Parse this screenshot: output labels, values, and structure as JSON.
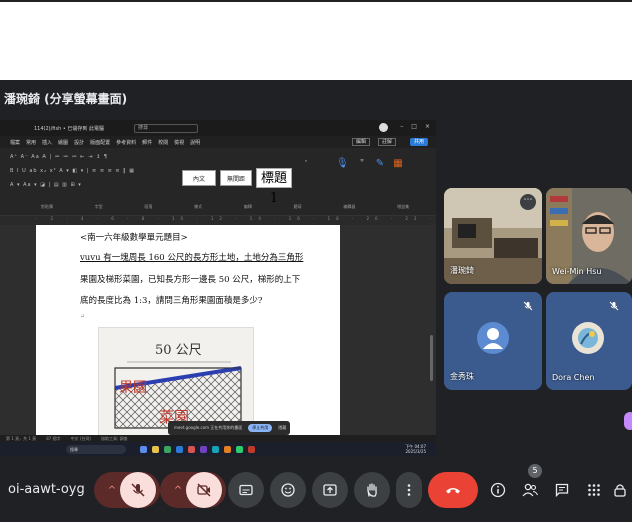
{
  "meeting": {
    "presenter_title": "潘琬錡 (分享螢幕畫面)",
    "meeting_code": "oi-aawt-oyg",
    "participant_count": "5"
  },
  "shared_screen": {
    "titlebar": {
      "doc_name": "114(2)/fish • 已儲存到 此電腦",
      "search": "搜尋",
      "win_buttons": [
        "–",
        "□",
        "×"
      ]
    },
    "menu": [
      "檔案",
      "常用",
      "插入",
      "繪圖",
      "設計",
      "版面配置",
      "參考資料",
      "郵件",
      "校閱",
      "檢視",
      "說明"
    ],
    "menu_buttons": {
      "edit": "編輯",
      "comment": "註解",
      "share": "共用"
    },
    "ribbon": {
      "styles": [
        "內文",
        "無間距"
      ],
      "heading_style": "標題 1",
      "group_labels": [
        "剪貼簿",
        "字型",
        "段落",
        "樣式",
        "編輯",
        "聽寫",
        "編輯器",
        "增益集"
      ]
    },
    "document": {
      "lines": [
        "<南一六年級數學單元題目>",
        "vuvu 有一塊周長 160 公尺的長方形土地，土地分為三角形",
        "果園及梯形菜園，已知長方形一邊長 50 公尺，梯形的上下",
        "底的長度比為 1:3，請問三角形果園面積是多少?",
        "↵"
      ],
      "sketch": {
        "label_top": "50 公尺",
        "label_left": "果園",
        "label_right": "菜園"
      }
    },
    "toast": {
      "text": "meet.google.com 正在共用你的畫面",
      "stop": "停止共用",
      "hide": "隱藏"
    },
    "statusbar": [
      "第 1 頁，共 1 頁",
      "87 個字",
      "中文 (台灣)",
      "協助工具: 調查"
    ],
    "taskbar": {
      "search": "搜尋",
      "time": "下午 04:07",
      "date": "2025/3/25"
    }
  },
  "participants": [
    {
      "name": "潘琬錡"
    },
    {
      "name": "Wei-Min Hsu"
    },
    {
      "name": "金秀珠"
    },
    {
      "name": "Dora Chen"
    }
  ],
  "colors": {
    "meet_bg": "#202124",
    "tile_blue": "#3b5b8f",
    "end_call": "#ea4335",
    "muted_soft": "#f9dedc",
    "avatar_blue": "#5c8bd1"
  },
  "icons": {
    "mic": "mic-off-icon",
    "camera": "camera-off-icon",
    "captions": "captions-icon",
    "emoji": "emoji-icon",
    "present": "present-icon",
    "hand": "raise-hand-icon",
    "more": "more-vert-icon",
    "end": "call-end-icon",
    "info": "info-icon",
    "people": "people-icon",
    "chat": "chat-icon",
    "activities": "apps-icon",
    "host": "lock-icon"
  }
}
